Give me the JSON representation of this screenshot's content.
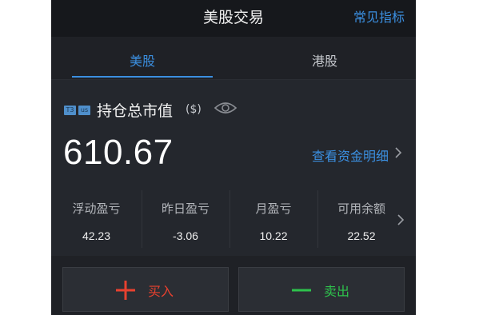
{
  "header": {
    "title": "美股交易",
    "indicators_link": "常见指标"
  },
  "tabs": [
    {
      "label": "美股",
      "active": true
    },
    {
      "label": "港股",
      "active": false
    }
  ],
  "account": {
    "badges": [
      "T3",
      "us"
    ],
    "holding_label": "持仓总市值",
    "currency": "($)",
    "total_value": "610.67",
    "detail_link": "查看资金明细",
    "eye_icon": "eye-icon"
  },
  "stats": [
    {
      "label": "浮动盈亏",
      "value": "42.23"
    },
    {
      "label": "昨日盈亏",
      "value": "-3.06"
    },
    {
      "label": "月盈亏",
      "value": "10.22"
    },
    {
      "label": "可用余额",
      "value": "22.52"
    }
  ],
  "actions": {
    "buy_label": "买入",
    "sell_label": "卖出"
  },
  "colors": {
    "accent": "#3b8fe0",
    "buy": "#e8412f",
    "sell": "#2ec24c",
    "background": "#1f2126"
  }
}
